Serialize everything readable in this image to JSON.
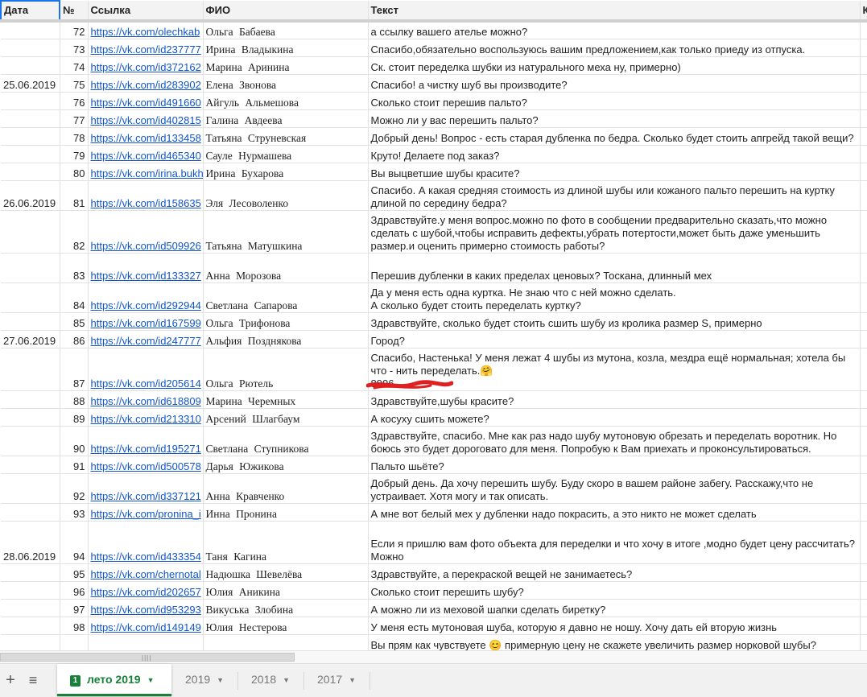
{
  "headers": [
    "Дата",
    "№",
    "Ссылка",
    "ФИО",
    "Текст",
    "К"
  ],
  "rows": [
    {
      "date": "",
      "num": "72",
      "link": "https://vk.com/olechkab",
      "fio": "Ольга Бабаева",
      "text": "а ссылку вашего ателье можно?"
    },
    {
      "date": "",
      "num": "73",
      "link": "https://vk.com/id237777",
      "fio": "Ирина Владыкина",
      "text": "Спасибо,обязательно воспользуюсь вашим предложением,как только приеду из отпуска."
    },
    {
      "date": "",
      "num": "74",
      "link": "https://vk.com/id372162",
      "fio": "Марина Аринина",
      "text": "Ск. стоит переделка шубки из натурального меха ну, примерно)"
    },
    {
      "date": "25.06.2019",
      "num": "75",
      "link": "https://vk.com/id283902",
      "fio": "Елена Звонова",
      "text": "Спасибо! а чистку шуб вы производите?"
    },
    {
      "date": "",
      "num": "76",
      "link": "https://vk.com/id491660",
      "fio": "Айгуль Альмешова",
      "text": "Сколько стоит перешив пальто?"
    },
    {
      "date": "",
      "num": "77",
      "link": "https://vk.com/id402815",
      "fio": "Галина Авдеева",
      "text": "Можно ли у вас перешить пальто?"
    },
    {
      "date": "",
      "num": "78",
      "link": "https://vk.com/id133458",
      "fio": "Татьяна Струневская",
      "text": "Добрый день! Вопрос - есть старая дубленка по бедра. Сколько будет стоить апгрейд такой вещи?"
    },
    {
      "date": "",
      "num": "79",
      "link": "https://vk.com/id465340",
      "fio": "Сауле Нурмашева",
      "text": "Круто! Делаете под заказ?"
    },
    {
      "date": "",
      "num": "80",
      "link": "https://vk.com/irina.bukh",
      "fio": "Ирина Бухарова",
      "text": "Вы выцветшие шубы красите?"
    },
    {
      "date": "26.06.2019",
      "num": "81",
      "link": "https://vk.com/id158635",
      "fio": "Эля Лесоволенко",
      "text": "Спасибо. А какая средняя стоимость из длиной шубы или кожаного пальто перешить на куртку длиной по середину бедра?"
    },
    {
      "date": "",
      "num": "82",
      "link": "https://vk.com/id509926",
      "fio": "Татьяна Матушкина",
      "text": "Здравствуйте.у меня вопрос.можно по фото в сообщении предварительно сказать,что можно сделать с шубой,чтобы исправить дефекты,убрать потертости,может быть даже уменьшить размер.и оценить примерно стоимость работы?"
    },
    {
      "date": "",
      "num": "83",
      "link": "https://vk.com/id133327",
      "fio": "Анна Морозова",
      "text": "Перешив дубленки в каких пределах ценовых? Тоскана, длинный мех"
    },
    {
      "date": "",
      "num": "84",
      "link": "https://vk.com/id292944",
      "fio": "Светлана Сапарова",
      "text": "Да у меня есть одна куртка. Не знаю что с ней можно сделать.\nА сколько будет стоить переделать куртку?"
    },
    {
      "date": "",
      "num": "85",
      "link": "https://vk.com/id167599",
      "fio": "Ольга Трифонова",
      "text": "Здравствуйте, сколько будет стоить сшить шубу из кролика размер S, примерно"
    },
    {
      "date": "27.06.2019",
      "num": "86",
      "link": "https://vk.com/id247777",
      "fio": "Альфия Позднякова",
      "text": "Город?"
    },
    {
      "date": "",
      "num": "87",
      "link": "https://vk.com/id205614",
      "fio": "Ольга Рютель",
      "text": "Спасибо, Настенька! У меня лежат 4 шубы из мутона, козла, мездра ещё нормальная; хотела бы что - нить переделать.🤗\n8906"
    },
    {
      "date": "",
      "num": "88",
      "link": "https://vk.com/id618809",
      "fio": "Марина Черемных",
      "text": "Здравствуйте,шубы красите?"
    },
    {
      "date": "",
      "num": "89",
      "link": "https://vk.com/id213310",
      "fio": "Арсений Шлагбаум",
      "text": "А косуху сшить можете?"
    },
    {
      "date": "",
      "num": "90",
      "link": "https://vk.com/id195271",
      "fio": "Светлана Ступникова",
      "text": "Здравствуйте, спасибо. Мне как раз надо шубу мутоновую обрезать и переделать воротник. Но боюсь это будет дороговато для меня. Попробую к Вам приехать и проконсультироваться."
    },
    {
      "date": "",
      "num": "91",
      "link": "https://vk.com/id500578",
      "fio": "Дарья Южикова",
      "text": "Пальто шьёте?"
    },
    {
      "date": "",
      "num": "92",
      "link": "https://vk.com/id337121",
      "fio": "Анна Кравченко",
      "text": "Добрый день. Да хочу перешить шубу. Буду скоро в вашем районе забегу. Расскажу,что не устраивает. Хотя могу и так описать."
    },
    {
      "date": "",
      "num": "93",
      "link": "https://vk.com/pronina_i",
      "fio": "Инна Пронина",
      "text": "А мне вот белый мех у дубленки надо покрасить, а это никто не может сделать"
    },
    {
      "date": "28.06.2019",
      "num": "94",
      "link": "https://vk.com/id433354",
      "fio": "Таня Кагина",
      "text": "Если я пришлю вам фото объекта для переделки и что хочу в итоге ,модно будет цену рассчитать?\nМожно"
    },
    {
      "date": "",
      "num": "95",
      "link": "https://vk.com/chernotal",
      "fio": "Надюшка Шевелёва",
      "text": "Здравствуйте, а перекраской вещей не занимаетесь?"
    },
    {
      "date": "",
      "num": "96",
      "link": "https://vk.com/id202657",
      "fio": "Юлия Аникина",
      "text": "Сколько стоит перешить шубу?"
    },
    {
      "date": "",
      "num": "97",
      "link": "https://vk.com/id953293",
      "fio": "Викуська Злобина",
      "text": "А можно ли из меховой шапки сделать биретку?"
    },
    {
      "date": "",
      "num": "98",
      "link": "https://vk.com/id149149",
      "fio": "Юлия Нестерова",
      "text": "У меня есть мутоновая шуба, которую я давно не ношу. Хочу дать ей вторую жизнь"
    },
    {
      "date": "",
      "num": "",
      "link": "",
      "fio": "",
      "text": "Вы прям как чувствуете 😊 примерную цену не скажете увеличить размер норковой шубы?"
    }
  ],
  "tabs": [
    {
      "label": "лето 2019",
      "active": true,
      "badge": "1"
    },
    {
      "label": "2019",
      "active": false
    },
    {
      "label": "2018",
      "active": false
    },
    {
      "label": "2017",
      "active": false
    }
  ],
  "colors": {
    "accent": "#1a73e8",
    "active_tab": "#188038",
    "link": "#1155cc"
  }
}
